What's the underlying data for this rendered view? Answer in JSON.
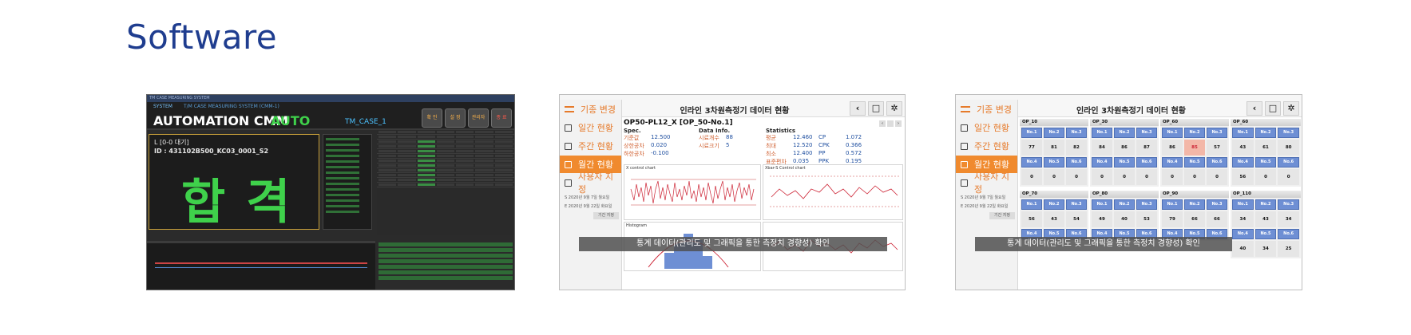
{
  "heading": "Software",
  "shot1": {
    "window_title": "TM CASE MEASURING SYSTEM",
    "logo": "SYSTEM",
    "subtitle": "T/M CASE MEASURING SYSTEM (CMM-1)",
    "title": "AUTOMATION CMM",
    "mode": "AUTO",
    "case": "TM_CASE_1",
    "buttons": [
      "확 인",
      "설 정",
      "관리자",
      "종 료"
    ],
    "status_line": "L [0-0 대기]",
    "id_line": "ID : 431102B500_KC03_0001_S2",
    "result": "합격"
  },
  "shot2": {
    "nav": [
      "기종 변경",
      "일간 현황",
      "주간 현황",
      "월간 현황",
      "사용자 지정"
    ],
    "selected_nav": "월간 현황",
    "date_start": "S  2020년  9월  7일 월요일",
    "date_end": "E  2020년  9월 22일 화요일",
    "query_button": "기간 지정",
    "title": "인라인 3차원측정기 데이터 현황",
    "part_label": "OP50-PL12_X [OP_50-No.1]",
    "spec": {
      "header": "Spec.",
      "rows": [
        [
          "기준값",
          "12.500"
        ],
        [
          "상한공차",
          "0.020"
        ],
        [
          "하한공차",
          "-0.100"
        ]
      ]
    },
    "data_info": {
      "header": "Data Info.",
      "rows": [
        [
          "시료개수",
          "88"
        ],
        [
          "시료크기",
          "5"
        ]
      ]
    },
    "statistics": {
      "header": "Statistics",
      "rows": [
        [
          "평균",
          "12.460",
          "CP",
          "1.072"
        ],
        [
          "최대",
          "12.520",
          "CPK",
          "0.366"
        ],
        [
          "최소",
          "12.400",
          "PP",
          "0.572"
        ],
        [
          "표준편차",
          "0.035",
          "PPK",
          "0.195"
        ]
      ]
    },
    "charts": [
      "X control chart",
      "Xbar-S Control chart",
      "Histogram"
    ],
    "caption": "통계 데이터(관리도 및 그래픽을 통한 측정치 경향성) 확인"
  },
  "shot3": {
    "nav": [
      "기종 변경",
      "일간 현황",
      "주간 현황",
      "월간 현황",
      "사용자 지정"
    ],
    "selected_nav": "월간 현황",
    "date_start": "S  2020년  9월  7일 월요일",
    "date_end": "E  2020년  9월 22일 화요일",
    "query_button": "기간 지정",
    "title": "인라인 3차원측정기 데이터 현황",
    "groups": [
      {
        "name": "OP_10",
        "top": [
          "77",
          "81",
          "82"
        ],
        "bottom": [
          "0",
          "0",
          "0"
        ]
      },
      {
        "name": "OP_30",
        "top": [
          "84",
          "86",
          "87"
        ],
        "bottom": [
          "0",
          "0",
          "0"
        ]
      },
      {
        "name": "OP_60",
        "top": [
          "86",
          "85",
          "57"
        ],
        "bottom": [
          "0",
          "0",
          "0"
        ]
      },
      {
        "name": "OP_60",
        "top": [
          "43",
          "61",
          "80"
        ],
        "bottom": [
          "56",
          "0",
          "0"
        ]
      },
      {
        "name": "OP_70",
        "top": [
          "56",
          "43",
          "54"
        ],
        "bottom": [
          "",
          "",
          ""
        ]
      },
      {
        "name": "OP_80",
        "top": [
          "49",
          "40",
          "53"
        ],
        "bottom": [
          "",
          "",
          ""
        ]
      },
      {
        "name": "OP_90",
        "top": [
          "79",
          "66",
          "66"
        ],
        "bottom": [
          "",
          "",
          ""
        ]
      },
      {
        "name": "OP_110",
        "top": [
          "34",
          "43",
          "34"
        ],
        "bottom": [
          "40",
          "34",
          "25"
        ]
      }
    ],
    "cell_labels_top": [
      "No.1",
      "No.2",
      "No.3"
    ],
    "cell_labels_bottom": [
      "No.4",
      "No.5",
      "No.6"
    ],
    "caption": "통계 데이터(관리도 및 그래픽을 통한 측정치 경향성) 확인"
  }
}
